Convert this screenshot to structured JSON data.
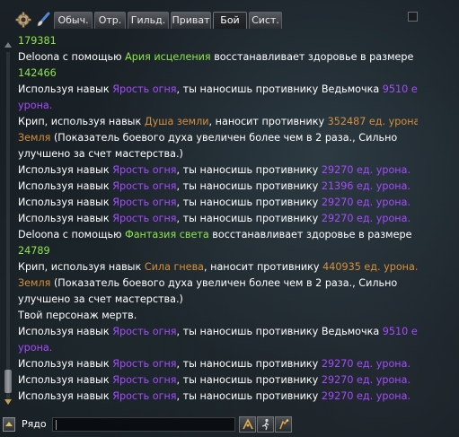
{
  "tabs": [
    {
      "label": "Обыч.",
      "active": false
    },
    {
      "label": "Отр.",
      "active": false
    },
    {
      "label": "Гильд.",
      "active": false
    },
    {
      "label": "Приват",
      "active": false
    },
    {
      "label": "Бой",
      "active": true
    },
    {
      "label": "Сист.",
      "active": false
    }
  ],
  "icons": {
    "settings": "gear-icon",
    "brush": "brush-icon",
    "close": "close-icon",
    "channel": "chevron-up-icon",
    "emote": "emote-icon",
    "action1": "running-figure-icon",
    "action2": "party-icon"
  },
  "colors": {
    "text": "#ffffff",
    "heal_value": "#8ee74a",
    "player_damage": "#a54bff",
    "enemy_damage": "#d7903a"
  },
  "chat": {
    "lines": [
      [
        {
          "t": "179381",
          "c": "g"
        }
      ],
      [
        {
          "t": "Deloona с помощью ",
          "c": "w"
        },
        {
          "t": "Ария исцеления",
          "c": "g"
        },
        {
          "t": " восстанавливает здоровье в размере",
          "c": "w"
        }
      ],
      [
        {
          "t": "142466",
          "c": "g"
        }
      ],
      [
        {
          "t": "Используя навык ",
          "c": "w"
        },
        {
          "t": "Ярость огня",
          "c": "p"
        },
        {
          "t": ", ты наносишь противнику Ведьмочка  ",
          "c": "w"
        },
        {
          "t": "9510 ед.",
          "c": "p"
        }
      ],
      [
        {
          "t": "урона.",
          "c": "p"
        }
      ],
      [
        {
          "t": "Крип, используя навык ",
          "c": "w"
        },
        {
          "t": "Душа земли",
          "c": "o"
        },
        {
          "t": ", наносит противнику  ",
          "c": "w"
        },
        {
          "t": "352487 ед. урона.",
          "c": "o"
        }
      ],
      [
        {
          "t": "Земля",
          "c": "o"
        },
        {
          "t": " (Показатель боевого духа увеличен более чем в 2 раза., Сильно",
          "c": "w"
        }
      ],
      [
        {
          "t": "улучшено за счет мастерства.)",
          "c": "w"
        }
      ],
      [
        {
          "t": "Используя навык ",
          "c": "w"
        },
        {
          "t": "Ярость огня",
          "c": "p"
        },
        {
          "t": ", ты наносишь противнику    ",
          "c": "w"
        },
        {
          "t": "29270 ед. урона.",
          "c": "p"
        }
      ],
      [
        {
          "t": "Используя навык ",
          "c": "w"
        },
        {
          "t": "Ярость огня",
          "c": "p"
        },
        {
          "t": ", ты наносишь противнику    ",
          "c": "w"
        },
        {
          "t": "21396 ед. урона.",
          "c": "p"
        }
      ],
      [
        {
          "t": "Используя навык ",
          "c": "w"
        },
        {
          "t": "Ярость огня",
          "c": "p"
        },
        {
          "t": ", ты наносишь противнику    ",
          "c": "w"
        },
        {
          "t": "29270 ед. урона.",
          "c": "p"
        }
      ],
      [
        {
          "t": "Используя навык ",
          "c": "w"
        },
        {
          "t": "Ярость огня",
          "c": "p"
        },
        {
          "t": ", ты наносишь противнику    ",
          "c": "w"
        },
        {
          "t": "29270 ед. урона.",
          "c": "p"
        }
      ],
      [
        {
          "t": "Deloona с помощью ",
          "c": "w"
        },
        {
          "t": "Фантазия света",
          "c": "g"
        },
        {
          "t": " восстанавливает здоровье в размере",
          "c": "w"
        }
      ],
      [
        {
          "t": "24789",
          "c": "g"
        }
      ],
      [
        {
          "t": "Крип, используя навык ",
          "c": "w"
        },
        {
          "t": "Сила гнева",
          "c": "o"
        },
        {
          "t": ", наносит противнику  ",
          "c": "w"
        },
        {
          "t": "440935 ед. урона.",
          "c": "o"
        }
      ],
      [
        {
          "t": "Земля",
          "c": "o"
        },
        {
          "t": " (Показатель боевого духа увеличен более чем в 2 раза., Сильно",
          "c": "w"
        }
      ],
      [
        {
          "t": "улучшено за счет мастерства.)",
          "c": "w"
        }
      ],
      [
        {
          "t": "Твой персонаж мертв.",
          "c": "w"
        }
      ],
      [
        {
          "t": "Используя навык ",
          "c": "w"
        },
        {
          "t": "Ярость огня",
          "c": "p"
        },
        {
          "t": ", ты наносишь противнику Ведьмочка  ",
          "c": "w"
        },
        {
          "t": "9510 ед.",
          "c": "p"
        }
      ],
      [
        {
          "t": "урона.",
          "c": "p"
        }
      ],
      [
        {
          "t": "Используя навык ",
          "c": "w"
        },
        {
          "t": "Ярость огня",
          "c": "p"
        },
        {
          "t": ", ты наносишь противнику    ",
          "c": "w"
        },
        {
          "t": "29270 ед. урона.",
          "c": "p"
        }
      ],
      [
        {
          "t": "Используя навык ",
          "c": "w"
        },
        {
          "t": "Ярость огня",
          "c": "p"
        },
        {
          "t": ", ты наносишь противнику    ",
          "c": "w"
        },
        {
          "t": "29270 ед. урона.",
          "c": "p"
        }
      ],
      [
        {
          "t": "Используя навык ",
          "c": "w"
        },
        {
          "t": "Ярость огня",
          "c": "p"
        },
        {
          "t": ", ты наносишь противнику    ",
          "c": "w"
        },
        {
          "t": "29270 ед. урона.",
          "c": "p"
        }
      ]
    ]
  },
  "input": {
    "channel_label": "Рядо",
    "value": ""
  }
}
